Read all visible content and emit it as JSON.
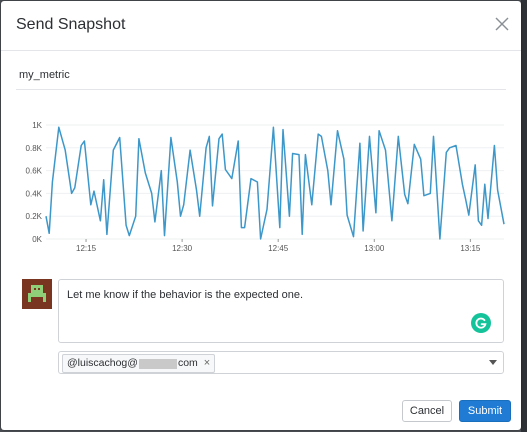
{
  "dialog": {
    "title": "Send Snapshot",
    "close_icon": "close-icon"
  },
  "metric_name": "my_metric",
  "comment": {
    "text": "Let me know if the behavior is the expected one.",
    "grammarly_icon": "grammarly-icon"
  },
  "recipients": {
    "chip_prefix": "@luiscachog@",
    "chip_suffix": "com",
    "remove_icon": "remove-icon",
    "dropdown_icon": "chevron-down-icon"
  },
  "buttons": {
    "cancel": "Cancel",
    "submit": "Submit"
  },
  "colors": {
    "line": "#3d97c9",
    "submit": "#1f7bd3",
    "avatar": "#7a3520",
    "avatar_glyph": "#8fcf77"
  },
  "chart_data": {
    "type": "line",
    "title": "",
    "xlabel": "",
    "ylabel": "",
    "ylim": [
      0,
      1000
    ],
    "y_ticks": [
      "0K",
      "0.2K",
      "0.4K",
      "0.6K",
      "0.8K",
      "1K"
    ],
    "y_tick_values": [
      0,
      200,
      400,
      600,
      800,
      1000
    ],
    "x_ticks": [
      "12:15",
      "12:30",
      "12:45",
      "13:00",
      "13:15"
    ],
    "x_tick_values": [
      12.5,
      42.5,
      72.5,
      102.5,
      132.5
    ],
    "x_range": [
      0,
      135
    ],
    "grid": true,
    "series": [
      {
        "values": [
          [
            0,
            200
          ],
          [
            1,
            50
          ],
          [
            2,
            500
          ],
          [
            4,
            980
          ],
          [
            6,
            780
          ],
          [
            8,
            400
          ],
          [
            9,
            450
          ],
          [
            11,
            820
          ],
          [
            12,
            860
          ],
          [
            14,
            300
          ],
          [
            15,
            420
          ],
          [
            17,
            160
          ],
          [
            18,
            520
          ],
          [
            19,
            40
          ],
          [
            21,
            780
          ],
          [
            23,
            890
          ],
          [
            25,
            120
          ],
          [
            26,
            30
          ],
          [
            28,
            200
          ],
          [
            29,
            880
          ],
          [
            31,
            580
          ],
          [
            33,
            400
          ],
          [
            34,
            150
          ],
          [
            36,
            600
          ],
          [
            37,
            30
          ],
          [
            39,
            890
          ],
          [
            41,
            500
          ],
          [
            42,
            200
          ],
          [
            43,
            300
          ],
          [
            45,
            780
          ],
          [
            47,
            430
          ],
          [
            48,
            200
          ],
          [
            50,
            800
          ],
          [
            51,
            900
          ],
          [
            52,
            290
          ],
          [
            54,
            880
          ],
          [
            55,
            920
          ],
          [
            56,
            610
          ],
          [
            58,
            530
          ],
          [
            60,
            860
          ],
          [
            61,
            100
          ],
          [
            62,
            100
          ],
          [
            64,
            530
          ],
          [
            66,
            500
          ],
          [
            67,
            0
          ],
          [
            69,
            260
          ],
          [
            71,
            980
          ],
          [
            73,
            100
          ],
          [
            74,
            960
          ],
          [
            76,
            200
          ],
          [
            77,
            750
          ],
          [
            79,
            740
          ],
          [
            80,
            40
          ],
          [
            81,
            740
          ],
          [
            83,
            300
          ],
          [
            85,
            920
          ],
          [
            86,
            900
          ],
          [
            88,
            600
          ],
          [
            89,
            300
          ],
          [
            91,
            950
          ],
          [
            93,
            700
          ],
          [
            94,
            210
          ],
          [
            96,
            20
          ],
          [
            98,
            840
          ],
          [
            99,
            70
          ],
          [
            101,
            900
          ],
          [
            103,
            230
          ],
          [
            104,
            950
          ],
          [
            106,
            780
          ],
          [
            108,
            160
          ],
          [
            110,
            900
          ],
          [
            112,
            390
          ],
          [
            113,
            310
          ],
          [
            115,
            830
          ],
          [
            117,
            700
          ],
          [
            118,
            380
          ],
          [
            120,
            400
          ],
          [
            121,
            900
          ],
          [
            123,
            0
          ],
          [
            125,
            760
          ],
          [
            126,
            800
          ],
          [
            128,
            820
          ],
          [
            130,
            480
          ],
          [
            131,
            350
          ],
          [
            132,
            210
          ],
          [
            134,
            650
          ],
          [
            135,
            160
          ],
          [
            136,
            120
          ],
          [
            137,
            480
          ],
          [
            138,
            180
          ],
          [
            140,
            820
          ],
          [
            141,
            430
          ],
          [
            143,
            130
          ]
        ]
      }
    ]
  }
}
